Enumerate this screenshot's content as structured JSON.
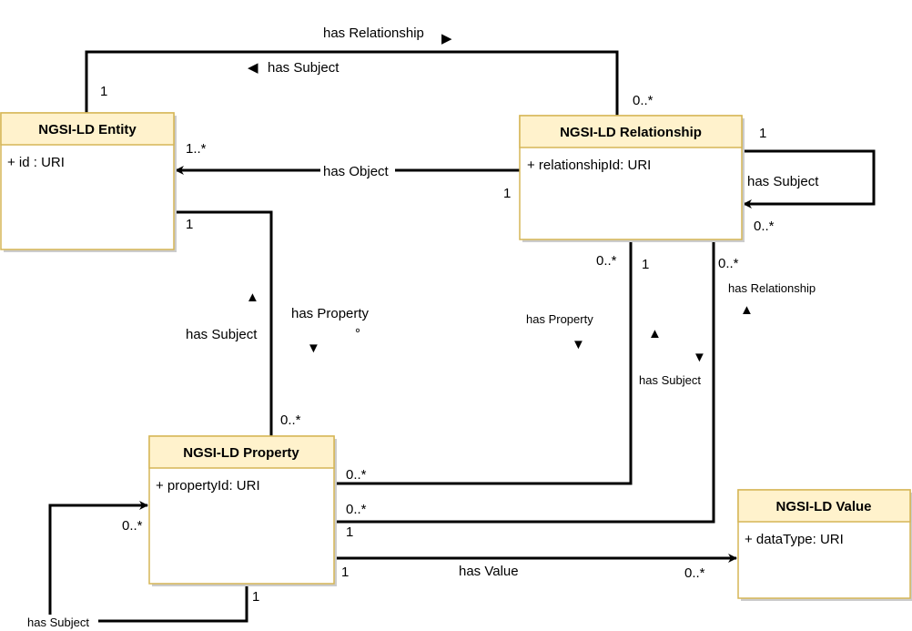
{
  "colors": {
    "header_fill": "#fff2cc",
    "border": "#d6b656",
    "line": "#000000"
  },
  "classes": {
    "entity": {
      "name": "NGSI-LD Entity",
      "attribute": "+ id : URI"
    },
    "relationship": {
      "name": "NGSI-LD Relationship",
      "attribute": "+ relationshipId: URI"
    },
    "property": {
      "name": "NGSI-LD Property",
      "attribute": "+ propertyId: URI"
    },
    "value": {
      "name": "NGSI-LD Value",
      "attribute": "+ dataType: URI"
    }
  },
  "edges": {
    "entity_relationship": {
      "label1": "has Relationship",
      "arrow1": "▶",
      "label2": "has Subject",
      "arrow2": "◀",
      "mult_entity": "1",
      "mult_rel": "0..*"
    },
    "has_object": {
      "label": "has Object",
      "mult_entity": "1..*",
      "mult_rel": "1"
    },
    "rel_self": {
      "label": "has Subject",
      "mult_src": "1",
      "mult_tgt": "0..*"
    },
    "entity_property": {
      "label1": "has Subject",
      "arrow1": "▲",
      "label2": "has Property",
      "arrow2": "▼",
      "mark": "°",
      "mult_entity": "1",
      "mult_prop": "0..*"
    },
    "rel_property": {
      "label": "has Property",
      "arrow": "▼",
      "mult_rel_a": "0..*",
      "mult_rel_b": "1",
      "mult_prop": "0..*"
    },
    "prop_relationship": {
      "label1": "has Relationship",
      "arrow1": "▲",
      "label2": "has Subject",
      "arrow2a": "▲",
      "arrow2b": "▼",
      "mult_rel": "0..*",
      "mult_prop_a": "0..*",
      "mult_prop_b": "1"
    },
    "has_value": {
      "label": "has Value",
      "mult_prop": "1",
      "mult_value": "0..*"
    },
    "prop_self": {
      "label": "has Subject",
      "mult_src": "1",
      "mult_tgt": "0..*"
    }
  }
}
